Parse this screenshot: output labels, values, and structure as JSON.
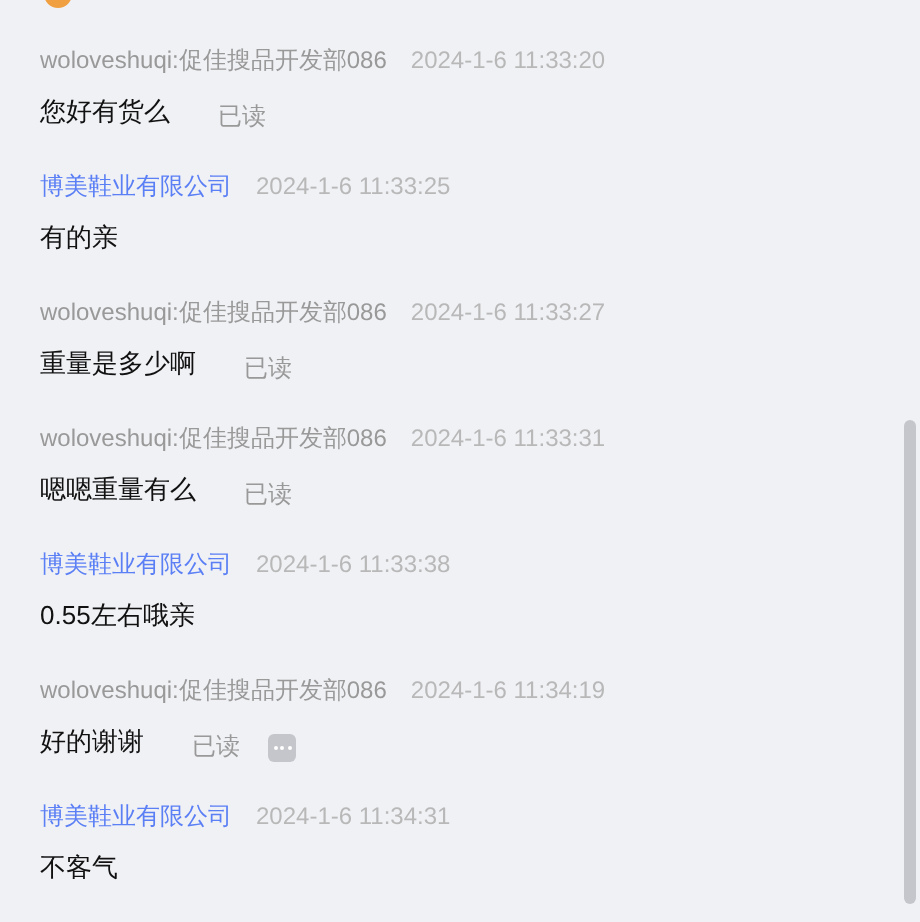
{
  "messages": [
    {
      "kind": "outgoing",
      "sender": "woloveshuqi:促佳搜品开发部086",
      "time": "2024-1-6 11:33:20",
      "text": "您好有货么",
      "status": "已读",
      "more": false
    },
    {
      "kind": "incoming",
      "sender": "博美鞋业有限公司",
      "time": "2024-1-6 11:33:25",
      "text": "有的亲"
    },
    {
      "kind": "outgoing",
      "sender": "woloveshuqi:促佳搜品开发部086",
      "time": "2024-1-6 11:33:27",
      "text": "重量是多少啊",
      "status": "已读",
      "more": false
    },
    {
      "kind": "outgoing",
      "sender": "woloveshuqi:促佳搜品开发部086",
      "time": "2024-1-6 11:33:31",
      "text": "嗯嗯重量有么",
      "status": "已读",
      "more": false
    },
    {
      "kind": "incoming",
      "sender": "博美鞋业有限公司",
      "time": "2024-1-6 11:33:38",
      "text": "0.55左右哦亲"
    },
    {
      "kind": "outgoing",
      "sender": "woloveshuqi:促佳搜品开发部086",
      "time": "2024-1-6 11:34:19",
      "text": "好的谢谢",
      "status": "已读",
      "more": true
    },
    {
      "kind": "incoming",
      "sender": "博美鞋业有限公司",
      "time": "2024-1-6 11:34:31",
      "text": "不客气"
    }
  ]
}
